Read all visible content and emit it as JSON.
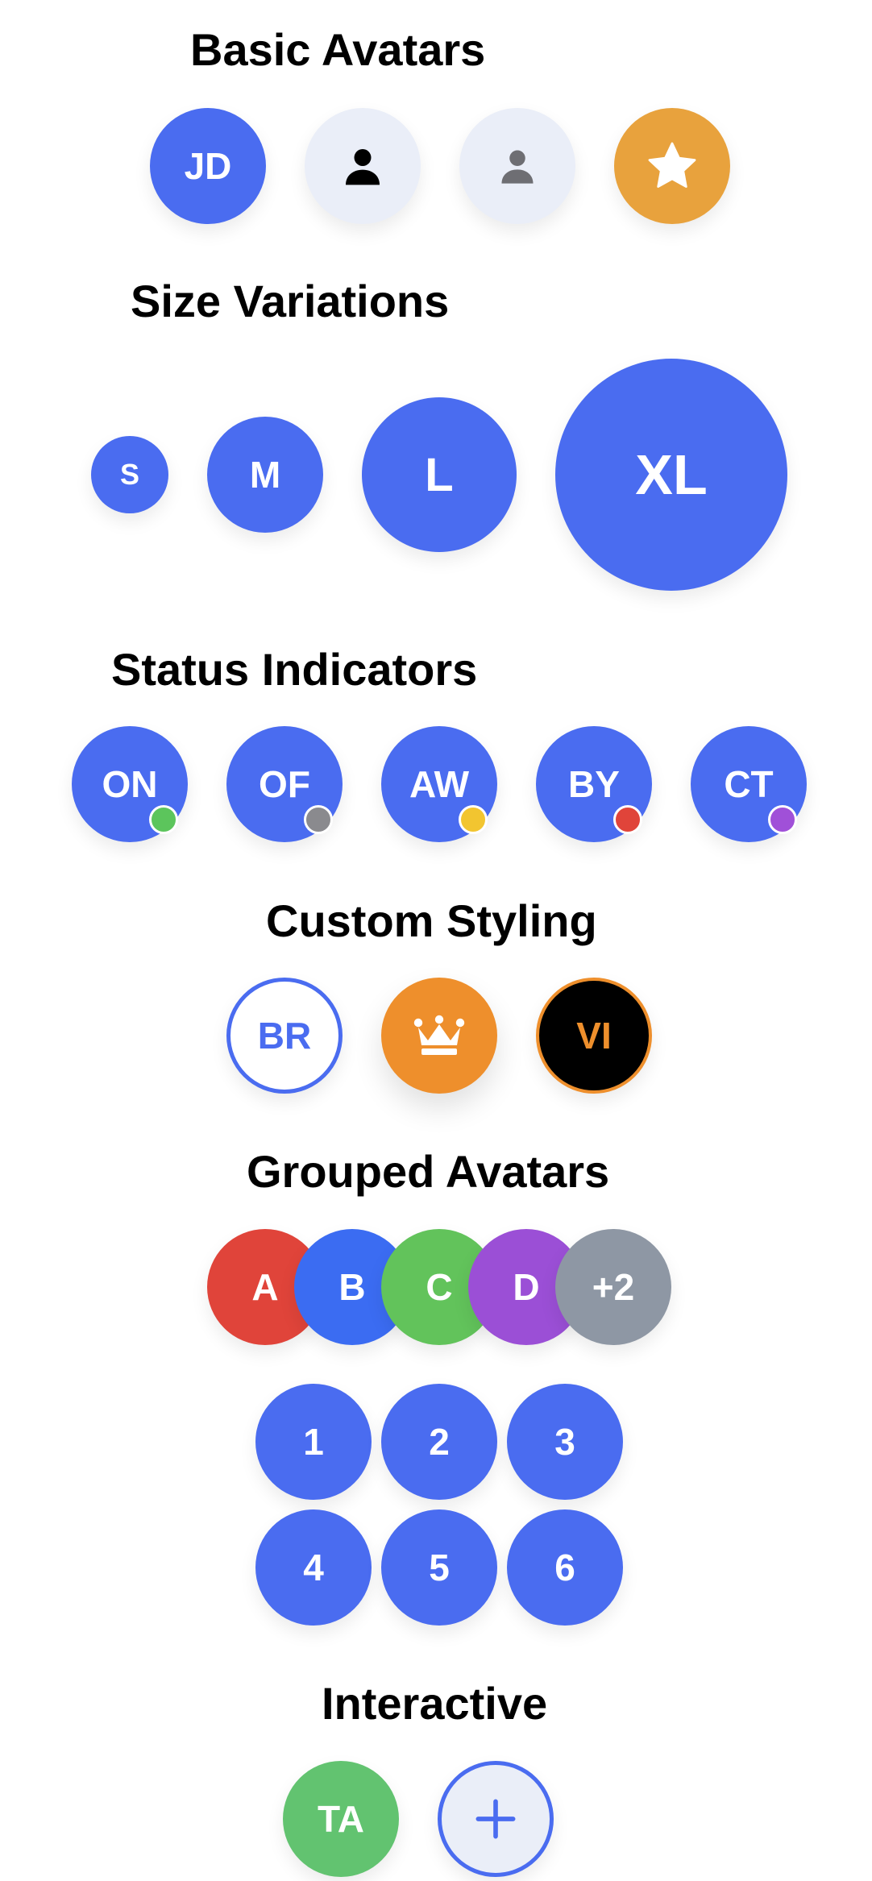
{
  "sections": {
    "basic": "Basic Avatars",
    "size": "Size Variations",
    "status": "Status Indicators",
    "custom": "Custom Styling",
    "grouped": "Grouped Avatars",
    "interactive": "Interactive"
  },
  "basic_avatars": [
    {
      "text": "JD"
    },
    {
      "icon": "person-icon"
    },
    {
      "icon": "person-icon"
    },
    {
      "icon": "star-icon"
    }
  ],
  "size_avatars": [
    "S",
    "M",
    "L",
    "XL"
  ],
  "status_avatars": [
    {
      "text": "ON",
      "status_color": "#5cc55c"
    },
    {
      "text": "OF",
      "status_color": "#8a8a8e"
    },
    {
      "text": "AW",
      "status_color": "#f2c530"
    },
    {
      "text": "BY",
      "status_color": "#e0443a"
    },
    {
      "text": "CT",
      "status_color": "#a050d8"
    }
  ],
  "custom_avatars": [
    {
      "text": "BR"
    },
    {
      "icon": "crown-icon"
    },
    {
      "text": "VI"
    }
  ],
  "grouped_avatars": [
    {
      "text": "A",
      "color": "#e0443a"
    },
    {
      "text": "B",
      "color": "#3b6cf2"
    },
    {
      "text": "C",
      "color": "#62c35b"
    },
    {
      "text": "D",
      "color": "#9b4fd6"
    },
    {
      "text": "+2",
      "color": "#8e97a4"
    }
  ],
  "grid_avatars": [
    "1",
    "2",
    "3",
    "4",
    "5",
    "6"
  ],
  "interactive_avatars": [
    {
      "text": "TA"
    },
    {
      "icon": "plus-icon"
    }
  ],
  "colors": {
    "primary": "#4a6cf0",
    "light": "#eaeef8",
    "orange": "#e8a23d",
    "crown_orange": "#ee8f2c",
    "green": "#62c370"
  }
}
